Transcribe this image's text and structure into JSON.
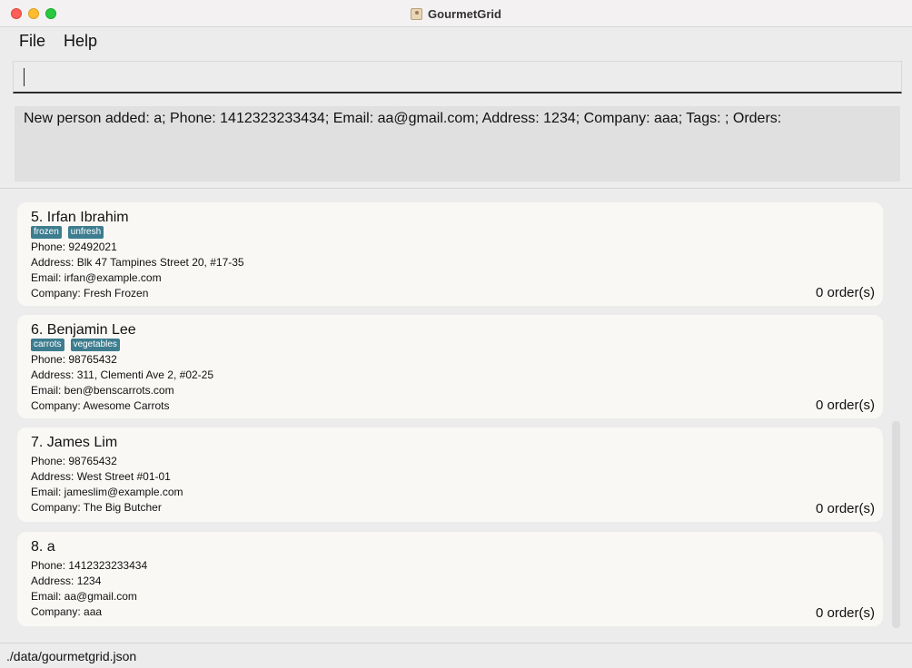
{
  "window": {
    "title": "GourmetGrid"
  },
  "menu": {
    "file": "File",
    "help": "Help"
  },
  "command": {
    "value": "",
    "placeholder": ""
  },
  "result": {
    "text": "New person added: a; Phone: 1412323233434; Email: aa@gmail.com; Address: 1234; Company: aaa; Tags: ; Orders:"
  },
  "persons": [
    {
      "name": "5.  Irfan Ibrahim",
      "tags": [
        "frozen",
        "unfresh"
      ],
      "phone": "Phone: 92492021",
      "address": "Address: Blk 47 Tampines Street 20, #17-35",
      "email": "Email: irfan@example.com",
      "company": "Company: Fresh Frozen",
      "orders": "0 order(s)"
    },
    {
      "name": "6.  Benjamin Lee",
      "tags": [
        "carrots",
        "vegetables"
      ],
      "phone": "Phone: 98765432",
      "address": "Address: 311, Clementi Ave 2, #02-25",
      "email": "Email: ben@benscarrots.com",
      "company": "Company: Awesome Carrots",
      "orders": "0 order(s)"
    },
    {
      "name": "7.  James Lim",
      "tags": [],
      "phone": "Phone: 98765432",
      "address": "Address: West Street #01-01",
      "email": "Email: jameslim@example.com",
      "company": "Company: The Big Butcher",
      "orders": "0 order(s)"
    },
    {
      "name": "8.  a",
      "tags": [],
      "phone": "Phone: 1412323233434",
      "address": "Address: 1234",
      "email": "Email: aa@gmail.com",
      "company": "Company: aaa",
      "orders": "0 order(s)"
    }
  ],
  "status": {
    "path": "./data/gourmetgrid.json"
  },
  "colors": {
    "tag": "#3d7d8f",
    "card": "#f9f8f5",
    "result_bg": "#e0e0e0"
  }
}
